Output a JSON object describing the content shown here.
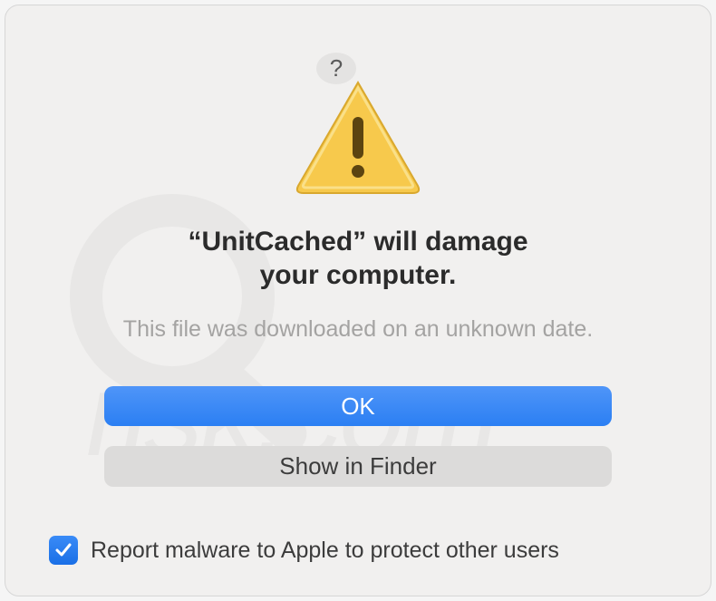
{
  "dialog": {
    "help_label": "?",
    "title_line1": "“UnitCached” will damage",
    "title_line2": "your computer.",
    "subtitle": "This file was downloaded on an unknown date.",
    "buttons": {
      "ok": "OK",
      "show_in_finder": "Show in Finder"
    },
    "checkbox": {
      "checked": true,
      "label": "Report malware to Apple to protect other users"
    }
  },
  "watermark": {
    "text": "pcrisk.com"
  }
}
